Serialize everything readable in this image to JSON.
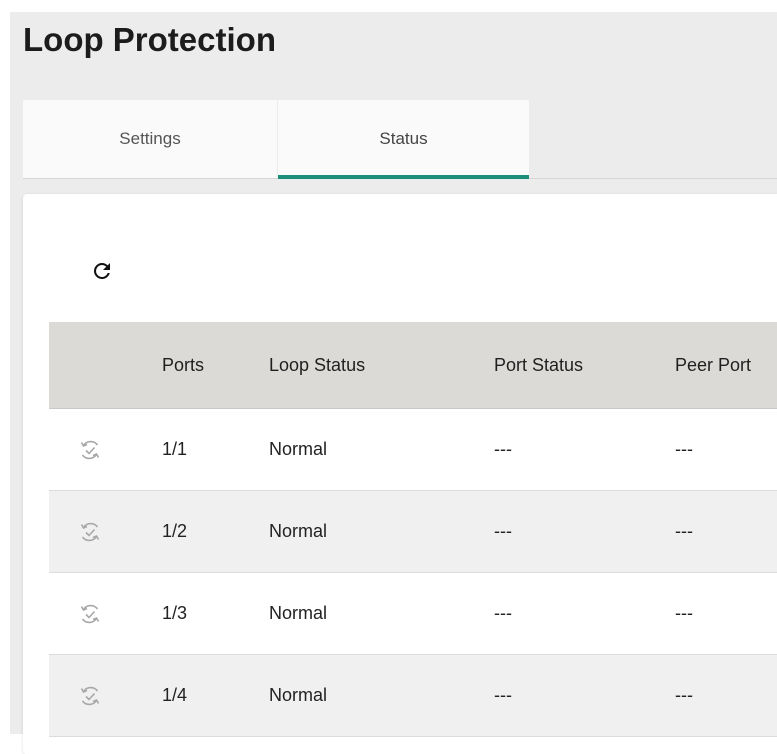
{
  "page": {
    "title": "Loop Protection"
  },
  "tabs": [
    {
      "label": "Settings",
      "active": false
    },
    {
      "label": "Status",
      "active": true
    }
  ],
  "toolbar": {
    "refresh_icon": "refresh-icon"
  },
  "table": {
    "columns": [
      "Ports",
      "Loop Status",
      "Port Status",
      "Peer Port"
    ],
    "rows": [
      {
        "port": "1/1",
        "loop_status": "Normal",
        "port_status": "---",
        "peer_port": "---"
      },
      {
        "port": "1/2",
        "loop_status": "Normal",
        "port_status": "---",
        "peer_port": "---"
      },
      {
        "port": "1/3",
        "loop_status": "Normal",
        "port_status": "---",
        "peer_port": "---"
      },
      {
        "port": "1/4",
        "loop_status": "Normal",
        "port_status": "---",
        "peer_port": "---"
      }
    ],
    "row_icon": "loop-normal-icon"
  },
  "colors": {
    "accent": "#1b8f79",
    "header_bg": "#dcdad7",
    "stripe_bg": "#f0f0f0",
    "page_bg": "#ececec"
  }
}
